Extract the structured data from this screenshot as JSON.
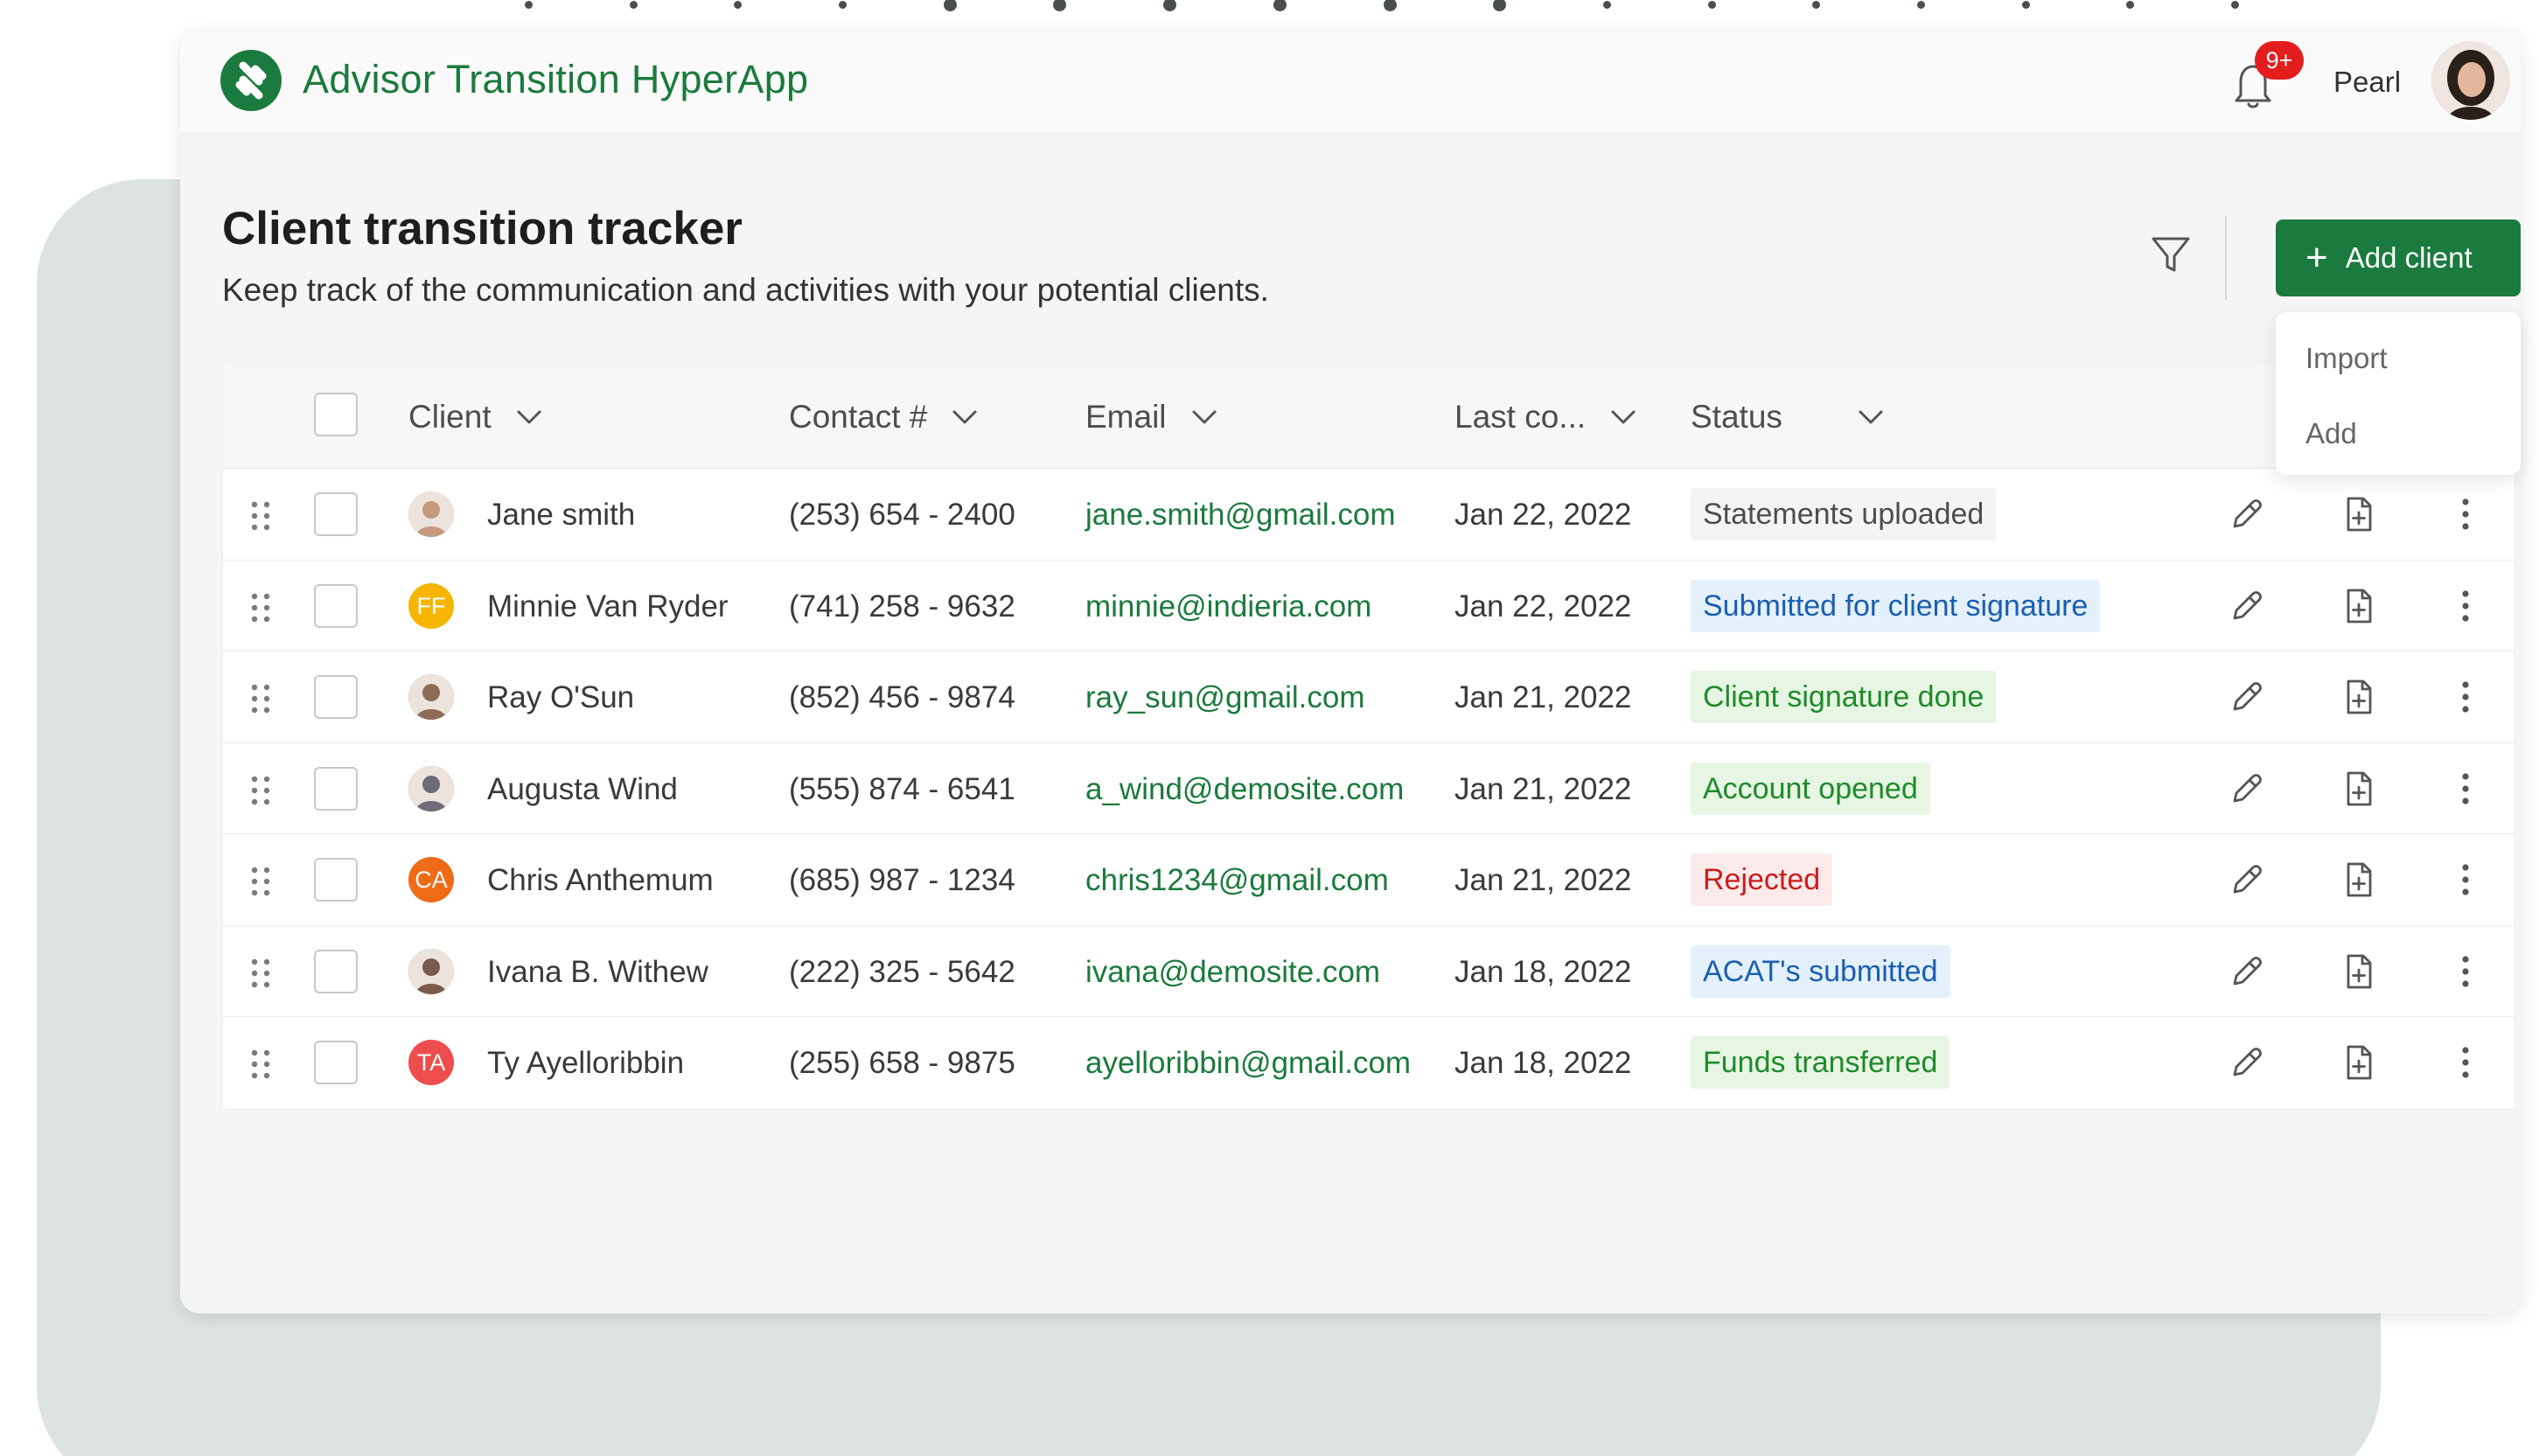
{
  "app": {
    "title": "Advisor Transition HyperApp",
    "notification_badge": "9+",
    "user_name": "Pearl"
  },
  "page": {
    "title": "Client transition tracker",
    "subtitle": "Keep track of the communication and activities with your potential clients.",
    "add_button_label": "Add client",
    "add_menu": [
      "Import",
      "Add"
    ]
  },
  "table": {
    "columns": [
      "Client",
      "Contact #",
      "Email",
      "Last co...",
      "Status"
    ],
    "rows": [
      {
        "name": "Jane smith",
        "initials": "",
        "avatar_color": "#c59b7e",
        "contact": "(253) 654 - 2400",
        "email": "jane.smith@gmail.com",
        "date": "Jan 22, 2022",
        "status": "Statements uploaded",
        "status_color": "#4d4d4d",
        "status_bg": "#f4f4f4"
      },
      {
        "name": "Minnie Van Ryder",
        "initials": "FF",
        "avatar_color": "#f6b500",
        "contact": "(741) 258 - 9632",
        "email": "minnie@indieria.com",
        "date": "Jan 22, 2022",
        "status": "Submitted for client signature",
        "status_color": "#1a5fb0",
        "status_bg": "#e4f0fb"
      },
      {
        "name": "Ray O'Sun",
        "initials": "",
        "avatar_color": "#8e6b56",
        "contact": "(852) 456 - 9874",
        "email": "ray_sun@gmail.com",
        "date": "Jan 21, 2022",
        "status": "Client signature done",
        "status_color": "#1f8a2a",
        "status_bg": "#e6f6e3"
      },
      {
        "name": "Augusta Wind",
        "initials": "",
        "avatar_color": "#6e6a78",
        "contact": "(555) 874 - 6541",
        "email": "a_wind@demosite.com",
        "date": "Jan 21, 2022",
        "status": "Account opened",
        "status_color": "#1f8a2a",
        "status_bg": "#e6f6e3"
      },
      {
        "name": "Chris Anthemum",
        "initials": "CA",
        "avatar_color": "#ef6b18",
        "contact": "(685) 987 - 1234",
        "email": "chris1234@gmail.com",
        "date": "Jan 21, 2022",
        "status": "Rejected",
        "status_color": "#c81d1d",
        "status_bg": "#fbeaea"
      },
      {
        "name": "Ivana B. Withew",
        "initials": "",
        "avatar_color": "#7a5a4c",
        "contact": "(222) 325 - 5642",
        "email": "ivana@demosite.com",
        "date": "Jan 18, 2022",
        "status": "ACAT's submitted",
        "status_color": "#1a5fb0",
        "status_bg": "#e4f0fb"
      },
      {
        "name": "Ty Ayelloribbin",
        "initials": "TA",
        "avatar_color": "#ee4d4d",
        "contact": "(255) 658 - 9875",
        "email": "ayelloribbin@gmail.com",
        "date": "Jan 18, 2022",
        "status": "Funds transferred",
        "status_color": "#1f8a2a",
        "status_bg": "#e6f6e3"
      }
    ]
  },
  "colors": {
    "brand": "#1b7a3d",
    "badge": "#e31d1d"
  },
  "icons": [
    "app-logo-icon",
    "bell-icon",
    "filter-icon",
    "plus-icon",
    "chevron-down-icon",
    "drag-handle-icon",
    "edit-pencil-icon",
    "add-document-icon",
    "more-vertical-icon"
  ]
}
